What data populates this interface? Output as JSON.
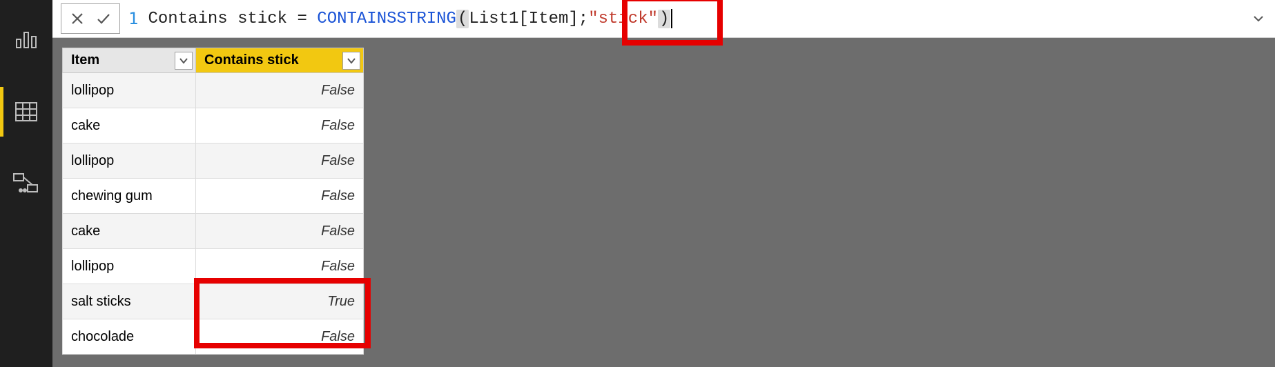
{
  "nav": {
    "items": [
      {
        "name": "report-view",
        "active": false
      },
      {
        "name": "data-view",
        "active": true
      },
      {
        "name": "model-view",
        "active": false
      }
    ]
  },
  "formula_bar": {
    "line_number": "1",
    "tokens": [
      {
        "cls": "tok-plain",
        "text": "Contains stick = "
      },
      {
        "cls": "tok-func",
        "text": "CONTAINSSTRING"
      },
      {
        "cls": "tok-paren",
        "text": "("
      },
      {
        "cls": "tok-ref",
        "text": "List1[Item]"
      },
      {
        "cls": "tok-semi",
        "text": ";"
      },
      {
        "cls": "tok-str",
        "text": "\"stick\""
      },
      {
        "cls": "tok-paren",
        "text": ")"
      }
    ]
  },
  "table": {
    "columns": [
      {
        "label": "Item",
        "calc": false
      },
      {
        "label": "Contains stick",
        "calc": true
      }
    ],
    "rows": [
      {
        "item": "lollipop",
        "val": "False"
      },
      {
        "item": "cake",
        "val": "False"
      },
      {
        "item": "lollipop",
        "val": "False"
      },
      {
        "item": "chewing gum",
        "val": "False"
      },
      {
        "item": "cake",
        "val": "False"
      },
      {
        "item": "lollipop",
        "val": "False"
      },
      {
        "item": "salt sticks",
        "val": "True"
      },
      {
        "item": "chocolade",
        "val": "False"
      }
    ]
  },
  "annotations": {
    "highlight_formula_segment": ";\"stick\")",
    "highlight_row_index": 6
  }
}
